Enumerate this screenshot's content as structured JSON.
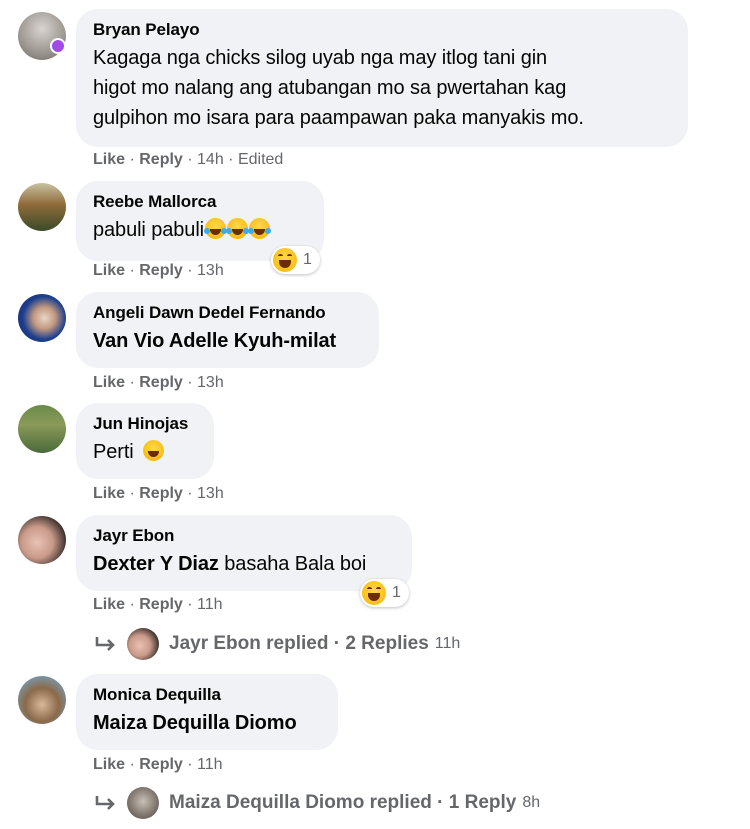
{
  "comments": [
    {
      "author": "Bryan Pelayo",
      "text_lines": [
        "Kagaga nga chicks silog uyab nga may itlog tani gin",
        "higot mo nalang ang atubangan mo sa pwertahan kag",
        "gulpihon mo isara para paampawan paka manyakis mo."
      ],
      "like": "Like",
      "reply": "Reply",
      "time": "14h",
      "edited": "Edited"
    },
    {
      "author": "Reebe Mallorca",
      "text": "pabuli pabuli",
      "reaction_count": "1",
      "like": "Like",
      "reply": "Reply",
      "time": "13h"
    },
    {
      "author": "Angeli Dawn Dedel Fernando",
      "mention": "Van Vio Adelle Kyuh-milat",
      "like": "Like",
      "reply": "Reply",
      "time": "13h"
    },
    {
      "author": "Jun Hinojas",
      "text": "Perti",
      "like": "Like",
      "reply": "Reply",
      "time": "13h"
    },
    {
      "author": "Jayr Ebon",
      "mention": "Dexter Y Diaz",
      "text": " basaha Bala boi",
      "reaction_count": "1",
      "like": "Like",
      "reply": "Reply",
      "time": "11h",
      "replies": {
        "label": "Jayr Ebon replied · 2 Replies",
        "time": "11h"
      }
    },
    {
      "author": "Monica Dequilla",
      "mention": "Maiza Dequilla Diomo",
      "like": "Like",
      "reply": "Reply",
      "time": "11h",
      "replies": {
        "label": "Maiza Dequilla Diomo replied · 1 Reply",
        "time": "8h"
      }
    }
  ],
  "sep": " · ",
  "colors": {
    "bubble": "#f0f2f5",
    "meta": "#65676b",
    "text": "#050505",
    "verified_badge": "#a04ae8"
  }
}
